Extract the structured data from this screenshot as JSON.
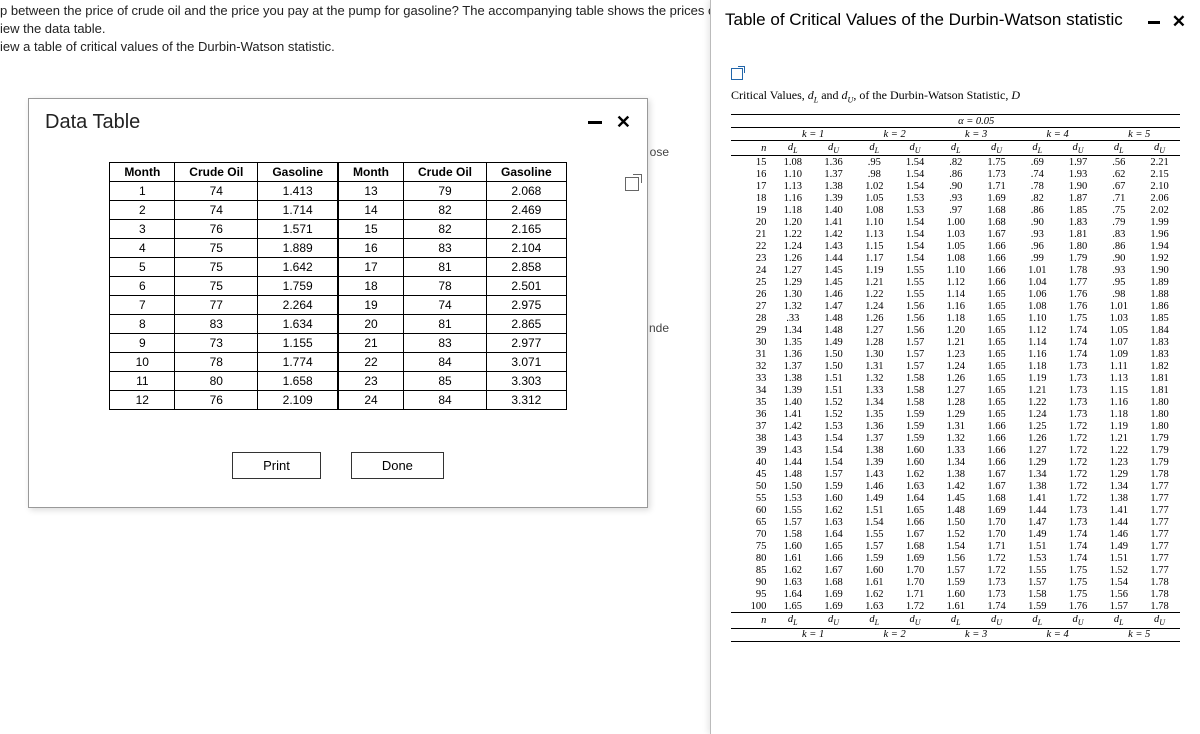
{
  "top_text": {
    "l1": "p between the price of crude oil and the price you pay at the pump for gasoline? The accompanying table shows the prices of crude",
    "l2": "iew the data table.",
    "l3": "iew a table of critical values of the Durbin-Watson statistic."
  },
  "left_modal": {
    "title": "Data Table",
    "side1": "ose",
    "side2": "nde",
    "print": "Print",
    "done": "Done",
    "cols": [
      "Month",
      "Crude Oil",
      "Gasoline"
    ],
    "rowsA": [
      [
        "1",
        "74",
        "1.413"
      ],
      [
        "2",
        "74",
        "1.714"
      ],
      [
        "3",
        "76",
        "1.571"
      ],
      [
        "4",
        "75",
        "1.889"
      ],
      [
        "5",
        "75",
        "1.642"
      ],
      [
        "6",
        "75",
        "1.759"
      ],
      [
        "7",
        "77",
        "2.264"
      ],
      [
        "8",
        "83",
        "1.634"
      ],
      [
        "9",
        "73",
        "1.155"
      ],
      [
        "10",
        "78",
        "1.774"
      ],
      [
        "11",
        "80",
        "1.658"
      ],
      [
        "12",
        "76",
        "2.109"
      ]
    ],
    "rowsB": [
      [
        "13",
        "79",
        "2.068"
      ],
      [
        "14",
        "82",
        "2.469"
      ],
      [
        "15",
        "82",
        "2.165"
      ],
      [
        "16",
        "83",
        "2.104"
      ],
      [
        "17",
        "81",
        "2.858"
      ],
      [
        "18",
        "78",
        "2.501"
      ],
      [
        "19",
        "74",
        "2.975"
      ],
      [
        "20",
        "81",
        "2.865"
      ],
      [
        "21",
        "83",
        "2.977"
      ],
      [
        "22",
        "84",
        "3.071"
      ],
      [
        "23",
        "85",
        "3.303"
      ],
      [
        "24",
        "84",
        "3.312"
      ]
    ]
  },
  "right_modal": {
    "title": "Table of Critical Values of the Durbin-Watson statistic",
    "caption_pre": "Critical Values, ",
    "caption_mid": " and ",
    "caption_post": " of the Durbin-Watson Statistic, ",
    "alpha": "α = 0.05",
    "k_labels": [
      "k = 1",
      "k = 2",
      "k = 3",
      "k = 4",
      "k = 5"
    ],
    "n_label": "n",
    "dL": "dL",
    "dU": "dU",
    "rows": [
      [
        "15",
        "1.08",
        "1.36",
        ".95",
        "1.54",
        ".82",
        "1.75",
        ".69",
        "1.97",
        ".56",
        "2.21"
      ],
      [
        "16",
        "1.10",
        "1.37",
        ".98",
        "1.54",
        ".86",
        "1.73",
        ".74",
        "1.93",
        ".62",
        "2.15"
      ],
      [
        "17",
        "1.13",
        "1.38",
        "1.02",
        "1.54",
        ".90",
        "1.71",
        ".78",
        "1.90",
        ".67",
        "2.10"
      ],
      [
        "18",
        "1.16",
        "1.39",
        "1.05",
        "1.53",
        ".93",
        "1.69",
        ".82",
        "1.87",
        ".71",
        "2.06"
      ],
      [
        "19",
        "1.18",
        "1.40",
        "1.08",
        "1.53",
        ".97",
        "1.68",
        ".86",
        "1.85",
        ".75",
        "2.02"
      ],
      [
        "20",
        "1.20",
        "1.41",
        "1.10",
        "1.54",
        "1.00",
        "1.68",
        ".90",
        "1.83",
        ".79",
        "1.99"
      ],
      [
        "21",
        "1.22",
        "1.42",
        "1.13",
        "1.54",
        "1.03",
        "1.67",
        ".93",
        "1.81",
        ".83",
        "1.96"
      ],
      [
        "22",
        "1.24",
        "1.43",
        "1.15",
        "1.54",
        "1.05",
        "1.66",
        ".96",
        "1.80",
        ".86",
        "1.94"
      ],
      [
        "23",
        "1.26",
        "1.44",
        "1.17",
        "1.54",
        "1.08",
        "1.66",
        ".99",
        "1.79",
        ".90",
        "1.92"
      ],
      [
        "24",
        "1.27",
        "1.45",
        "1.19",
        "1.55",
        "1.10",
        "1.66",
        "1.01",
        "1.78",
        ".93",
        "1.90"
      ],
      [
        "25",
        "1.29",
        "1.45",
        "1.21",
        "1.55",
        "1.12",
        "1.66",
        "1.04",
        "1.77",
        ".95",
        "1.89"
      ],
      [
        "26",
        "1.30",
        "1.46",
        "1.22",
        "1.55",
        "1.14",
        "1.65",
        "1.06",
        "1.76",
        ".98",
        "1.88"
      ],
      [
        "27",
        "1.32",
        "1.47",
        "1.24",
        "1.56",
        "1.16",
        "1.65",
        "1.08",
        "1.76",
        "1.01",
        "1.86"
      ],
      [
        "28",
        ".33",
        "1.48",
        "1.26",
        "1.56",
        "1.18",
        "1.65",
        "1.10",
        "1.75",
        "1.03",
        "1.85"
      ],
      [
        "29",
        "1.34",
        "1.48",
        "1.27",
        "1.56",
        "1.20",
        "1.65",
        "1.12",
        "1.74",
        "1.05",
        "1.84"
      ],
      [
        "30",
        "1.35",
        "1.49",
        "1.28",
        "1.57",
        "1.21",
        "1.65",
        "1.14",
        "1.74",
        "1.07",
        "1.83"
      ],
      [
        "31",
        "1.36",
        "1.50",
        "1.30",
        "1.57",
        "1.23",
        "1.65",
        "1.16",
        "1.74",
        "1.09",
        "1.83"
      ],
      [
        "32",
        "1.37",
        "1.50",
        "1.31",
        "1.57",
        "1.24",
        "1.65",
        "1.18",
        "1.73",
        "1.11",
        "1.82"
      ],
      [
        "33",
        "1.38",
        "1.51",
        "1.32",
        "1.58",
        "1.26",
        "1.65",
        "1.19",
        "1.73",
        "1.13",
        "1.81"
      ],
      [
        "34",
        "1.39",
        "1.51",
        "1.33",
        "1.58",
        "1.27",
        "1.65",
        "1.21",
        "1.73",
        "1.15",
        "1.81"
      ],
      [
        "35",
        "1.40",
        "1.52",
        "1.34",
        "1.58",
        "1.28",
        "1.65",
        "1.22",
        "1.73",
        "1.16",
        "1.80"
      ],
      [
        "36",
        "1.41",
        "1.52",
        "1.35",
        "1.59",
        "1.29",
        "1.65",
        "1.24",
        "1.73",
        "1.18",
        "1.80"
      ],
      [
        "37",
        "1.42",
        "1.53",
        "1.36",
        "1.59",
        "1.31",
        "1.66",
        "1.25",
        "1.72",
        "1.19",
        "1.80"
      ],
      [
        "38",
        "1.43",
        "1.54",
        "1.37",
        "1.59",
        "1.32",
        "1.66",
        "1.26",
        "1.72",
        "1.21",
        "1.79"
      ],
      [
        "39",
        "1.43",
        "1.54",
        "1.38",
        "1.60",
        "1.33",
        "1.66",
        "1.27",
        "1.72",
        "1.22",
        "1.79"
      ],
      [
        "40",
        "1.44",
        "1.54",
        "1.39",
        "1.60",
        "1.34",
        "1.66",
        "1.29",
        "1.72",
        "1.23",
        "1.79"
      ],
      [
        "45",
        "1.48",
        "1.57",
        "1.43",
        "1.62",
        "1.38",
        "1.67",
        "1.34",
        "1.72",
        "1.29",
        "1.78"
      ],
      [
        "50",
        "1.50",
        "1.59",
        "1.46",
        "1.63",
        "1.42",
        "1.67",
        "1.38",
        "1.72",
        "1.34",
        "1.77"
      ],
      [
        "55",
        "1.53",
        "1.60",
        "1.49",
        "1.64",
        "1.45",
        "1.68",
        "1.41",
        "1.72",
        "1.38",
        "1.77"
      ],
      [
        "60",
        "1.55",
        "1.62",
        "1.51",
        "1.65",
        "1.48",
        "1.69",
        "1.44",
        "1.73",
        "1.41",
        "1.77"
      ],
      [
        "65",
        "1.57",
        "1.63",
        "1.54",
        "1.66",
        "1.50",
        "1.70",
        "1.47",
        "1.73",
        "1.44",
        "1.77"
      ],
      [
        "70",
        "1.58",
        "1.64",
        "1.55",
        "1.67",
        "1.52",
        "1.70",
        "1.49",
        "1.74",
        "1.46",
        "1.77"
      ],
      [
        "75",
        "1.60",
        "1.65",
        "1.57",
        "1.68",
        "1.54",
        "1.71",
        "1.51",
        "1.74",
        "1.49",
        "1.77"
      ],
      [
        "80",
        "1.61",
        "1.66",
        "1.59",
        "1.69",
        "1.56",
        "1.72",
        "1.53",
        "1.74",
        "1.51",
        "1.77"
      ],
      [
        "85",
        "1.62",
        "1.67",
        "1.60",
        "1.70",
        "1.57",
        "1.72",
        "1.55",
        "1.75",
        "1.52",
        "1.77"
      ],
      [
        "90",
        "1.63",
        "1.68",
        "1.61",
        "1.70",
        "1.59",
        "1.73",
        "1.57",
        "1.75",
        "1.54",
        "1.78"
      ],
      [
        "95",
        "1.64",
        "1.69",
        "1.62",
        "1.71",
        "1.60",
        "1.73",
        "1.58",
        "1.75",
        "1.56",
        "1.78"
      ],
      [
        "100",
        "1.65",
        "1.69",
        "1.63",
        "1.72",
        "1.61",
        "1.74",
        "1.59",
        "1.76",
        "1.57",
        "1.78"
      ]
    ]
  }
}
